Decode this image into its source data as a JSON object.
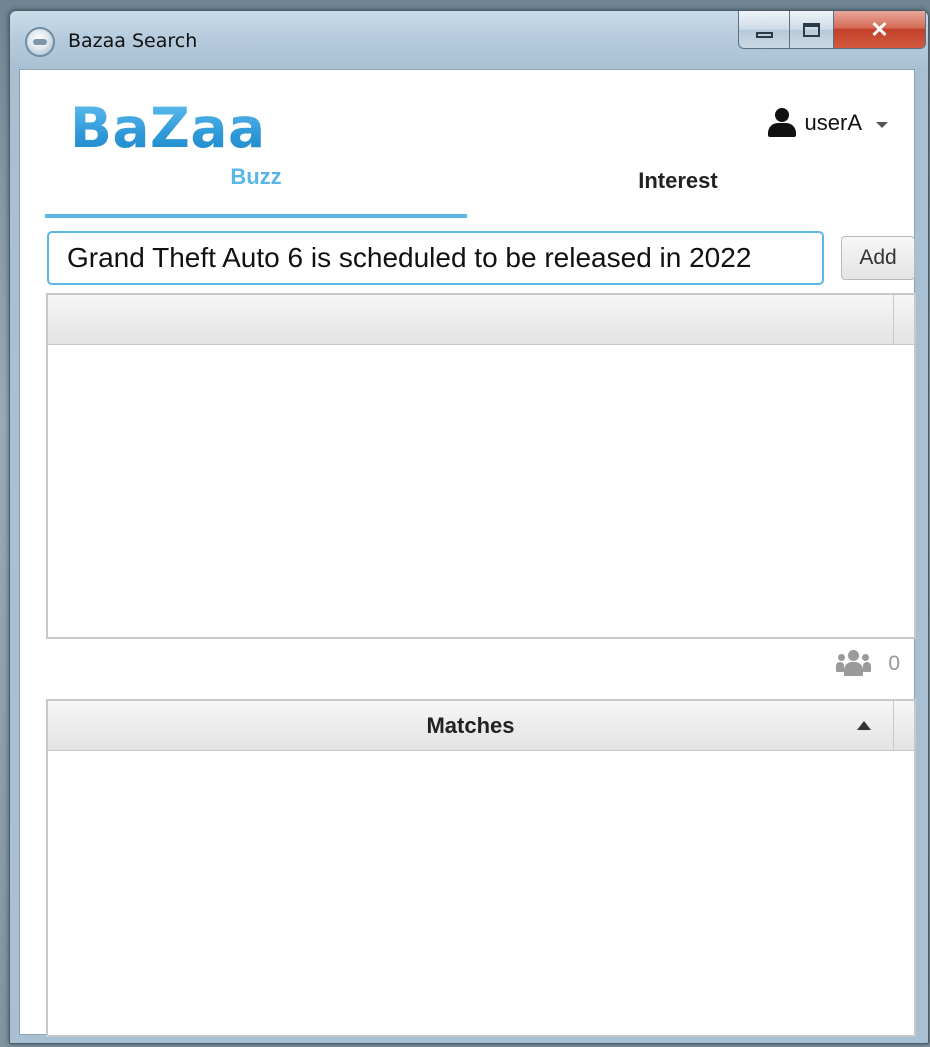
{
  "window": {
    "title": "Bazaa Search"
  },
  "app": {
    "logo": "BaZaa"
  },
  "user": {
    "name": "userA"
  },
  "tabs": [
    {
      "label": "Buzz",
      "active": true
    },
    {
      "label": "Interest",
      "active": false
    }
  ],
  "buzz_input": {
    "value": "Grand Theft Auto 6 is scheduled to be released in 2022"
  },
  "add_button": {
    "label": "Add"
  },
  "buzz_table": {
    "header": ""
  },
  "watchers": {
    "count": "0"
  },
  "matches_table": {
    "header": "Matches"
  },
  "colors": {
    "accent": "#5bb6e6",
    "logo": "#2e98d8",
    "close_button": "#c2402b"
  }
}
